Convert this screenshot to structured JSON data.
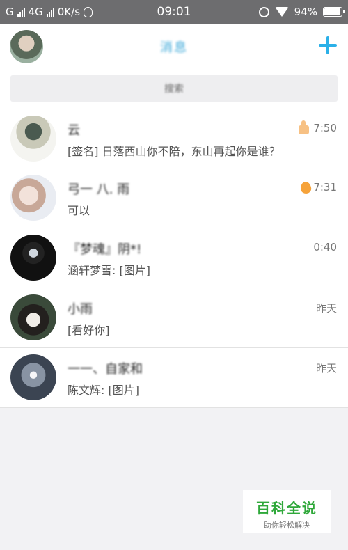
{
  "status_bar": {
    "carrier_1": "G",
    "carrier_2": "4G",
    "net_speed": "0K/s",
    "time": "09:01",
    "battery": "94%",
    "battery_level": 0.94,
    "icons": [
      "signal-icon",
      "qq-icon",
      "alarm-icon",
      "wifi-icon",
      "battery-icon"
    ]
  },
  "header": {
    "title": "消息",
    "add_icon": "plus-icon",
    "accent_color": "#2bb0e8"
  },
  "search": {
    "placeholder": "搜索"
  },
  "conversations": [
    {
      "name": "云",
      "message": "[签名] 日落西山你不陪，东山再起你是谁？",
      "time": "7:50",
      "badge": "thumbs-up-icon"
    },
    {
      "name": "弓一 八. 雨",
      "message": "可以",
      "time": "7:31",
      "badge": "flame-icon"
    },
    {
      "name": "『梦魂』阴*!",
      "message": "涵轩梦雪: [图片]",
      "time": "0:40",
      "badge": ""
    },
    {
      "name": "小雨",
      "message": "[看好你]",
      "time": "昨天",
      "badge": ""
    },
    {
      "name": "一一、自家和",
      "message": "陈文辉: [图片]",
      "time": "昨天",
      "badge": ""
    }
  ],
  "watermark": {
    "title": "百科全说",
    "subtitle": "助你轻松解决"
  }
}
